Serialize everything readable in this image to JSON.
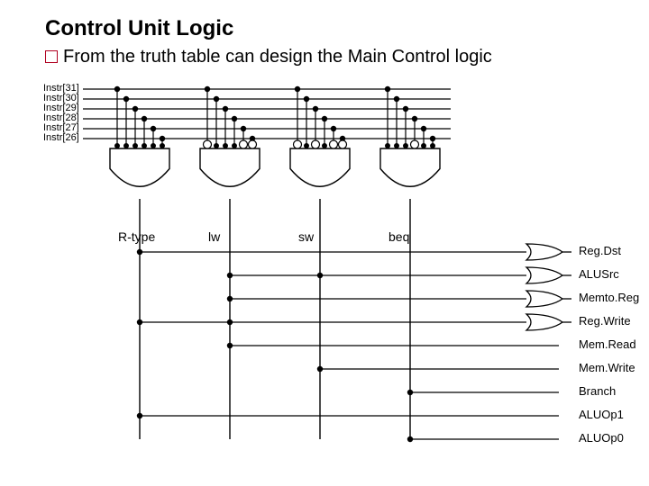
{
  "title": "Control Unit Logic",
  "subtitle": "From the truth table can design the Main Control logic",
  "inputs": [
    "Instr[31]",
    "Instr[30]",
    "Instr[29]",
    "Instr[28]",
    "Instr[27]",
    "Instr[26]"
  ],
  "gates": [
    "R-type",
    "lw",
    "sw",
    "beq"
  ],
  "outputs": [
    "Reg.Dst",
    "ALUSrc",
    "Memto.Reg",
    "Reg.Write",
    "Mem.Read",
    "Mem.Write",
    "Branch",
    "ALUOp1",
    "ALUOp0"
  ],
  "layout": {
    "inputsX": 48,
    "inputY0": 99,
    "inputDY": 11,
    "lineRight": 500,
    "gateCX": [
      155,
      255,
      355,
      455
    ],
    "gateTopY": 165,
    "gateOutY": 225,
    "gateLabelY": 255,
    "connDot": 3.2,
    "bubbleR": 4.5,
    "bubblePattern": [
      [
        0,
        0,
        0,
        0,
        0,
        0
      ],
      [
        1,
        0,
        0,
        0,
        1,
        1
      ],
      [
        1,
        0,
        1,
        0,
        1,
        1
      ],
      [
        0,
        0,
        0,
        1,
        0,
        0
      ]
    ],
    "spread": [
      -25,
      -15,
      -5,
      5,
      15,
      25
    ],
    "outY0": 280,
    "outDY": 26,
    "outXor": 620,
    "outLabelX": 642,
    "orOutputs": [
      0,
      1,
      2,
      3
    ],
    "connections": {
      "0": [
        0
      ],
      "1": [
        1,
        2
      ],
      "2": [
        1
      ],
      "3": [
        0,
        1
      ],
      "4": [
        1
      ],
      "5": [
        2
      ],
      "6": [
        3
      ],
      "7": [
        0
      ],
      "8": [
        3
      ]
    }
  }
}
